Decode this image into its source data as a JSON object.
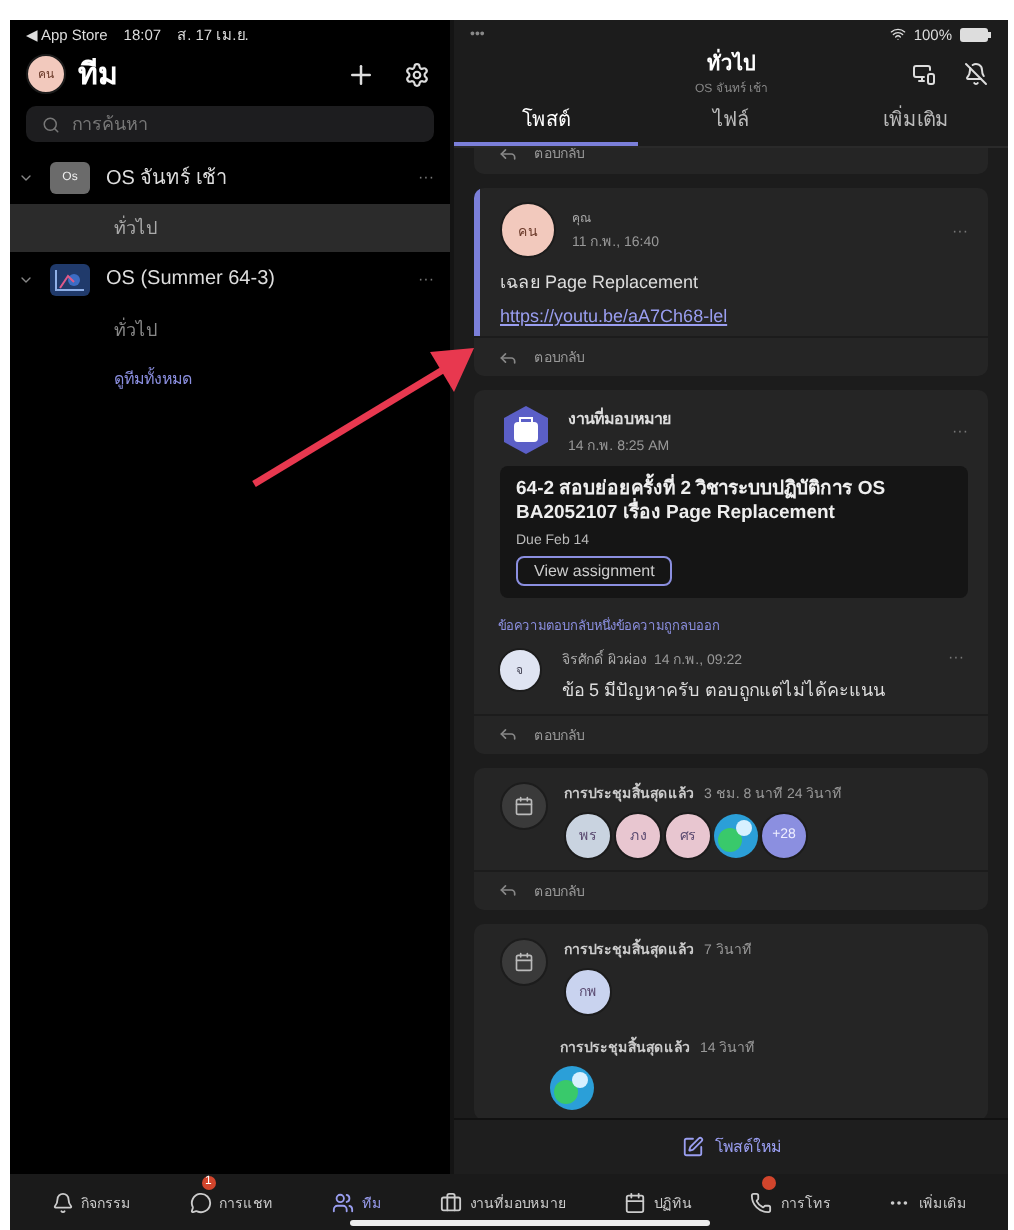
{
  "status_bar": {
    "back": "◀ App Store",
    "time": "18:07",
    "date": "ส. 17 เม.ย.",
    "dots": "•••",
    "battery": "100%"
  },
  "sidebar": {
    "avatar": "คน",
    "title": "ทีม",
    "search": {
      "placeholder": "การค้นหา"
    },
    "teams": [
      {
        "name": "OS จันทร์ เช้า",
        "avatar": "Os",
        "kind": "initials",
        "expanded": true,
        "more": "···",
        "channels": [
          {
            "name": "ทั่วไป",
            "selected": true
          }
        ]
      },
      {
        "name": "OS (Summer 64-3)",
        "kind": "picture",
        "expanded": true,
        "more": "···",
        "channels": [
          {
            "name": "ทั่วไป",
            "selected": false
          }
        ]
      }
    ],
    "all_teams": "ดูทีมทั้งหมด"
  },
  "header": {
    "title": "ทั่วไป",
    "subtitle": "OS จันทร์ เช้า"
  },
  "tabs": [
    {
      "label": "โพสต์",
      "selected": true
    },
    {
      "label": "ไฟล์",
      "selected": false
    },
    {
      "label": "เพิ่มเติม",
      "selected": false
    }
  ],
  "cut_reply": "ตอบกลับ",
  "posts": [
    {
      "kind": "message",
      "highlighted": true,
      "avatar": "คน",
      "author": "คุณ",
      "time": "11 ก.พ., 16:40",
      "more": "···",
      "body": "เฉลย Page Replacement",
      "link": "https://youtu.be/aA7Ch68-lel",
      "reply": "ตอบกลับ"
    },
    {
      "kind": "assignment",
      "highlighted": false,
      "author": "งานที่มอบหมาย",
      "time": "14 ก.พ. 8:25 AM",
      "more": "···",
      "card_title": "64-2 สอบย่อยครั้งที่ 2 วิชาระบบปฏิบัติการ OS BA2052107 เรื่อง Page Replacement",
      "due": "Due Feb 14",
      "button": "View assignment",
      "notice": "ข้อความตอบกลับหนึ่งข้อความถูกลบออก",
      "replies": [
        {
          "avatar": "จ",
          "author": "จิรศักดิ์ ผิวผ่อง",
          "time": "14 ก.พ., 09:22",
          "body": "ข้อ 5 มีปัญหาครับ ตอบถูกแต่ไม่ได้คะแนน",
          "more": "···"
        }
      ],
      "reply": "ตอบกลับ"
    },
    {
      "kind": "meeting",
      "highlighted": false,
      "events": [
        {
          "title": "การประชุมสิ้นสุดแล้ว",
          "duration": "3 ชม. 8 นาที 24 วินาที",
          "participants": [
            {
              "kind": "initials",
              "text": "พร",
              "color": "#c9d3e0"
            },
            {
              "kind": "initials",
              "text": "ภง",
              "color": "#e8c6d0"
            },
            {
              "kind": "initials",
              "text": "ศร",
              "color": "#e8c6d0"
            },
            {
              "kind": "picture"
            },
            {
              "kind": "count",
              "text": "+28",
              "color": "#8b8fe0"
            }
          ]
        }
      ],
      "reply": "ตอบกลับ"
    },
    {
      "kind": "meeting",
      "highlighted": false,
      "events": [
        {
          "title": "การประชุมสิ้นสุดแล้ว",
          "duration": "7 วินาที",
          "participants": [
            {
              "kind": "initials",
              "text": "กพ",
              "color": "#c9d3ef"
            }
          ]
        },
        {
          "title": "การประชุมสิ้นสุดแล้ว",
          "duration": "14 วินาที",
          "participants": [
            {
              "kind": "picture"
            }
          ]
        }
      ]
    }
  ],
  "new_post": "โพสต์ใหม่",
  "bottom_nav": [
    {
      "label": "กิจกรรม",
      "selected": false
    },
    {
      "label": "การแชท",
      "badge": "1",
      "selected": false
    },
    {
      "label": "ทีม",
      "selected": true
    },
    {
      "label": "งานที่มอบหมาย",
      "selected": false
    },
    {
      "label": "ปฏิทิน",
      "selected": false
    },
    {
      "label": "การโทร",
      "dot": true,
      "selected": false
    },
    {
      "label": "เพิ่มเติม",
      "selected": false
    }
  ]
}
